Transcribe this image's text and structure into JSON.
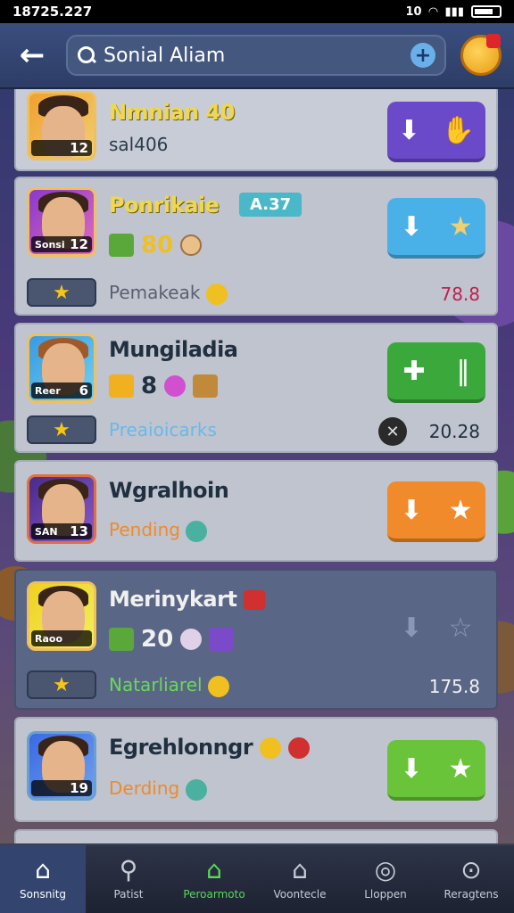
{
  "status_bar": {
    "time": "18725.227",
    "signal_text": "10"
  },
  "header": {
    "search_value": "Sonial Aliam"
  },
  "cards": [
    {
      "name": "Nmnian 40",
      "level": "12",
      "sub": "sal406"
    },
    {
      "name": "Ponrikaie",
      "badge": "A.37",
      "tag": "Sonsi",
      "level": "12",
      "count": "80",
      "sub": "Pemakeak",
      "value": "78.8"
    },
    {
      "name": "Mungiladia",
      "tag": "Reer",
      "level": "6",
      "count": "8",
      "sub": "Preaioicarks",
      "value": "20.28"
    },
    {
      "name": "Wgralhoin",
      "tag": "SAN",
      "level": "13",
      "sub": "Pending"
    },
    {
      "name": "Merinykart",
      "tag": "Raoo",
      "level": "",
      "count": "20",
      "sub": "Natarliarel",
      "value": "175.8"
    },
    {
      "name": "Egrehlonngr",
      "level": "19",
      "sub": "Derding"
    }
  ],
  "nav": [
    {
      "label": "Sonsnitg",
      "icon": "home-icon"
    },
    {
      "label": "Patist",
      "icon": "search-icon"
    },
    {
      "label": "Peroarmoto",
      "icon": "house-icon"
    },
    {
      "label": "Voontecle",
      "icon": "notification-house-icon"
    },
    {
      "label": "Lloppen",
      "icon": "record-icon"
    },
    {
      "label": "Reragtens",
      "icon": "download-icon"
    }
  ],
  "colors": {
    "header_bg": "#2d3d66",
    "card_bg": "#c8ccd6",
    "accent_orange": "#f08a2a",
    "accent_green": "#3aa83a",
    "accent_purple": "#6a4ac8",
    "accent_blue": "#4ab0e8"
  }
}
